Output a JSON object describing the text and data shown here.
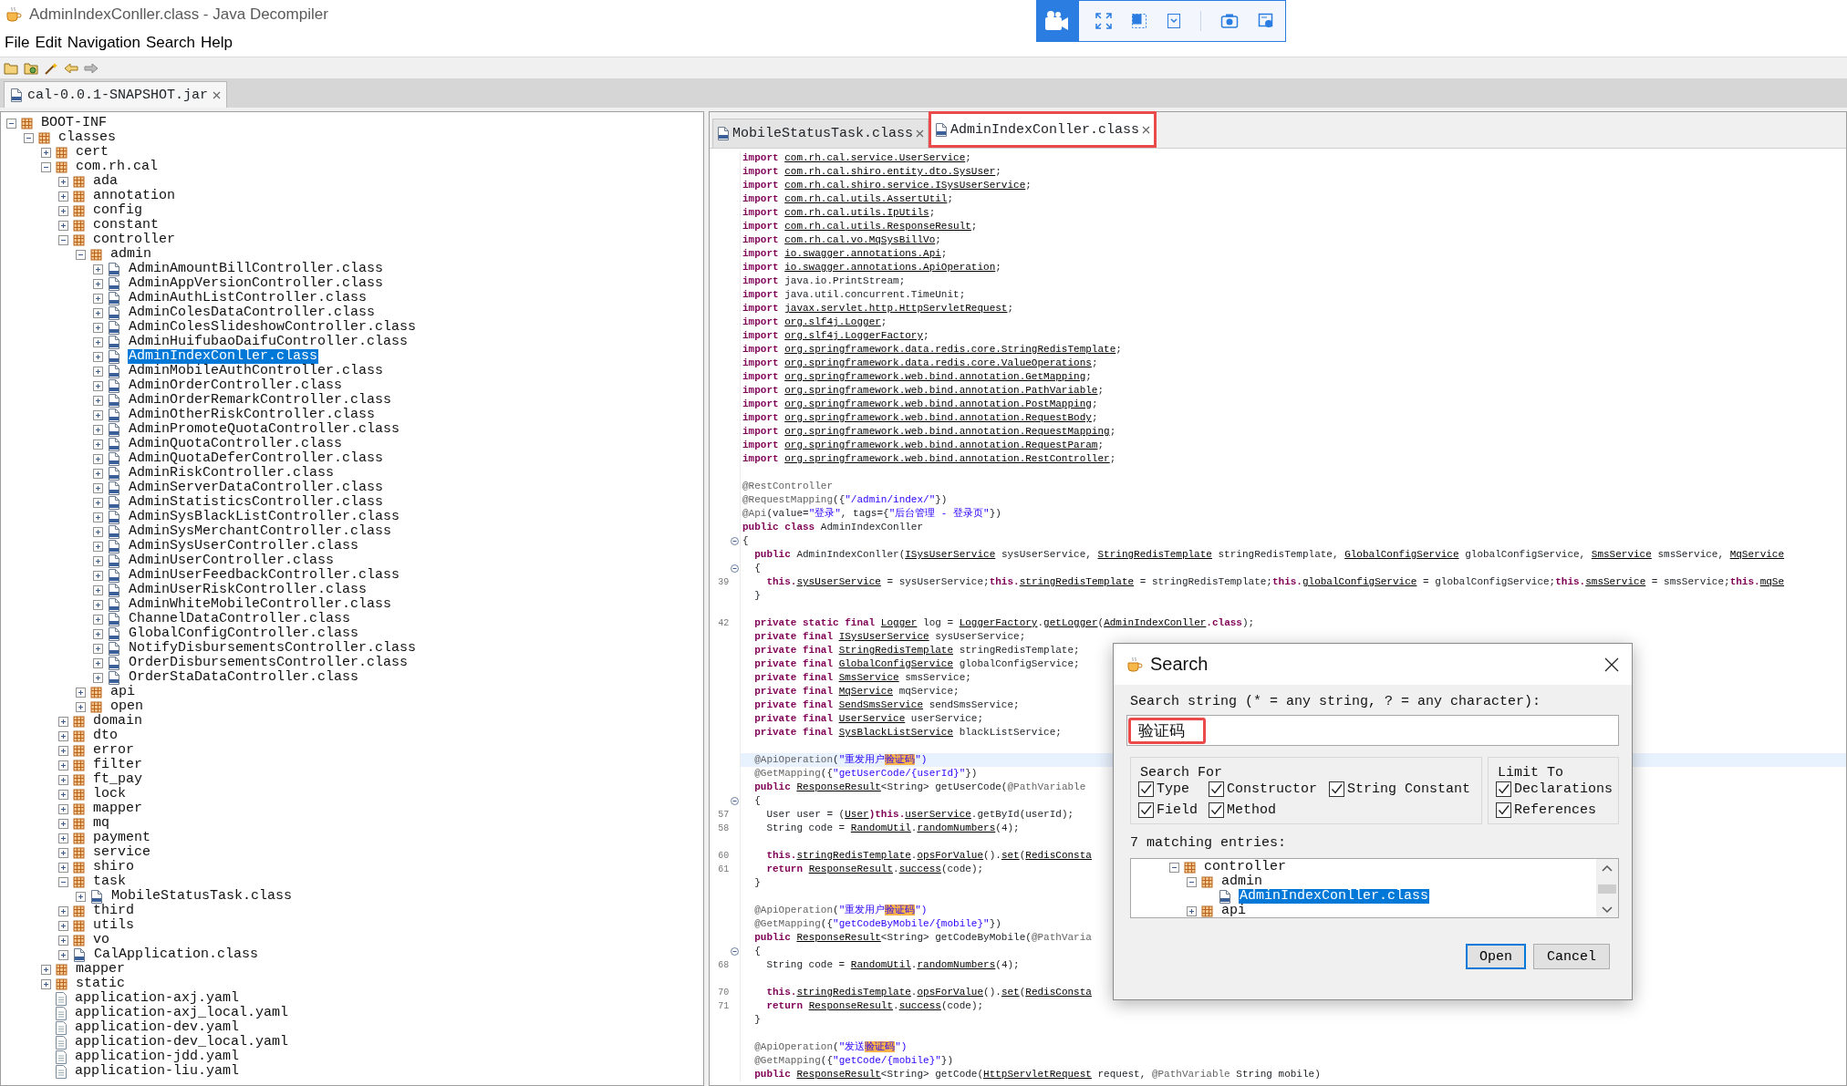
{
  "window": {
    "title": "AdminIndexConller.class - Java Decompiler"
  },
  "menu": [
    "File",
    "Edit",
    "Navigation",
    "Search",
    "Help"
  ],
  "file_tabs": [
    {
      "label": "cal-0.0.1-SNAPSHOT.jar",
      "selected": true
    }
  ],
  "tree": [
    {
      "label": "BOOT-INF",
      "kind": "package",
      "expanded": true,
      "selected": false,
      "children": [
        {
          "label": "classes",
          "kind": "package",
          "expanded": true,
          "selected": false,
          "children": [
            {
              "label": "cert",
              "kind": "package",
              "expanded": false,
              "selected": false
            },
            {
              "label": "com.rh.cal",
              "kind": "package",
              "expanded": true,
              "selected": false,
              "children": [
                {
                  "label": "ada",
                  "kind": "package",
                  "expanded": false,
                  "selected": false
                },
                {
                  "label": "annotation",
                  "kind": "package",
                  "expanded": false,
                  "selected": false
                },
                {
                  "label": "config",
                  "kind": "package",
                  "expanded": false,
                  "selected": false
                },
                {
                  "label": "constant",
                  "kind": "package",
                  "expanded": false,
                  "selected": false
                },
                {
                  "label": "controller",
                  "kind": "package",
                  "expanded": true,
                  "selected": false,
                  "children": [
                    {
                      "label": "admin",
                      "kind": "package",
                      "expanded": true,
                      "selected": false,
                      "children": [
                        {
                          "label": "AdminAmountBillController.class",
                          "kind": "class",
                          "expanded": false,
                          "selected": false
                        },
                        {
                          "label": "AdminAppVersionController.class",
                          "kind": "class",
                          "expanded": false,
                          "selected": false
                        },
                        {
                          "label": "AdminAuthListController.class",
                          "kind": "class",
                          "expanded": false,
                          "selected": false
                        },
                        {
                          "label": "AdminColesDataController.class",
                          "kind": "class",
                          "expanded": false,
                          "selected": false
                        },
                        {
                          "label": "AdminColesSlideshowController.class",
                          "kind": "class",
                          "expanded": false,
                          "selected": false
                        },
                        {
                          "label": "AdminHuifubaoDaifuController.class",
                          "kind": "class",
                          "expanded": false,
                          "selected": false
                        },
                        {
                          "label": "AdminIndexConller.class",
                          "kind": "class",
                          "expanded": false,
                          "selected": true
                        },
                        {
                          "label": "AdminMobileAuthController.class",
                          "kind": "class",
                          "expanded": false,
                          "selected": false
                        },
                        {
                          "label": "AdminOrderController.class",
                          "kind": "class",
                          "expanded": false,
                          "selected": false
                        },
                        {
                          "label": "AdminOrderRemarkController.class",
                          "kind": "class",
                          "expanded": false,
                          "selected": false
                        },
                        {
                          "label": "AdminOtherRiskController.class",
                          "kind": "class",
                          "expanded": false,
                          "selected": false
                        },
                        {
                          "label": "AdminPromoteQuotaController.class",
                          "kind": "class",
                          "expanded": false,
                          "selected": false
                        },
                        {
                          "label": "AdminQuotaController.class",
                          "kind": "class",
                          "expanded": false,
                          "selected": false
                        },
                        {
                          "label": "AdminQuotaDeferController.class",
                          "kind": "class",
                          "expanded": false,
                          "selected": false
                        },
                        {
                          "label": "AdminRiskController.class",
                          "kind": "class",
                          "expanded": false,
                          "selected": false
                        },
                        {
                          "label": "AdminServerDataController.class",
                          "kind": "class",
                          "expanded": false,
                          "selected": false
                        },
                        {
                          "label": "AdminStatisticsController.class",
                          "kind": "class",
                          "expanded": false,
                          "selected": false
                        },
                        {
                          "label": "AdminSysBlackListController.class",
                          "kind": "class",
                          "expanded": false,
                          "selected": false
                        },
                        {
                          "label": "AdminSysMerchantController.class",
                          "kind": "class",
                          "expanded": false,
                          "selected": false
                        },
                        {
                          "label": "AdminSysUserController.class",
                          "kind": "class",
                          "expanded": false,
                          "selected": false
                        },
                        {
                          "label": "AdminUserController.class",
                          "kind": "class",
                          "expanded": false,
                          "selected": false
                        },
                        {
                          "label": "AdminUserFeedbackController.class",
                          "kind": "class",
                          "expanded": false,
                          "selected": false
                        },
                        {
                          "label": "AdminUserRiskController.class",
                          "kind": "class",
                          "expanded": false,
                          "selected": false
                        },
                        {
                          "label": "AdminWhiteMobileController.class",
                          "kind": "class",
                          "expanded": false,
                          "selected": false
                        },
                        {
                          "label": "ChannelDataController.class",
                          "kind": "class",
                          "expanded": false,
                          "selected": false
                        },
                        {
                          "label": "GlobalConfigController.class",
                          "kind": "class",
                          "expanded": false,
                          "selected": false
                        },
                        {
                          "label": "NotifyDisbursementsController.class",
                          "kind": "class",
                          "expanded": false,
                          "selected": false
                        },
                        {
                          "label": "OrderDisbursementsController.class",
                          "kind": "class",
                          "expanded": false,
                          "selected": false
                        },
                        {
                          "label": "OrderStaDataController.class",
                          "kind": "class",
                          "expanded": false,
                          "selected": false
                        }
                      ]
                    },
                    {
                      "label": "api",
                      "kind": "package",
                      "expanded": false,
                      "selected": false
                    },
                    {
                      "label": "open",
                      "kind": "package",
                      "expanded": false,
                      "selected": false
                    }
                  ]
                },
                {
                  "label": "domain",
                  "kind": "package",
                  "expanded": false,
                  "selected": false
                },
                {
                  "label": "dto",
                  "kind": "package",
                  "expanded": false,
                  "selected": false
                },
                {
                  "label": "error",
                  "kind": "package",
                  "expanded": false,
                  "selected": false
                },
                {
                  "label": "filter",
                  "kind": "package",
                  "expanded": false,
                  "selected": false
                },
                {
                  "label": "ft_pay",
                  "kind": "package",
                  "expanded": false,
                  "selected": false
                },
                {
                  "label": "lock",
                  "kind": "package",
                  "expanded": false,
                  "selected": false
                },
                {
                  "label": "mapper",
                  "kind": "package",
                  "expanded": false,
                  "selected": false
                },
                {
                  "label": "mq",
                  "kind": "package",
                  "expanded": false,
                  "selected": false
                },
                {
                  "label": "payment",
                  "kind": "package",
                  "expanded": false,
                  "selected": false
                },
                {
                  "label": "service",
                  "kind": "package",
                  "expanded": false,
                  "selected": false
                },
                {
                  "label": "shiro",
                  "kind": "package",
                  "expanded": false,
                  "selected": false
                },
                {
                  "label": "task",
                  "kind": "package",
                  "expanded": true,
                  "selected": false,
                  "children": [
                    {
                      "label": "MobileStatusTask.class",
                      "kind": "class",
                      "expanded": false,
                      "selected": false
                    }
                  ]
                },
                {
                  "label": "third",
                  "kind": "package",
                  "expanded": false,
                  "selected": false
                },
                {
                  "label": "utils",
                  "kind": "package",
                  "expanded": false,
                  "selected": false
                },
                {
                  "label": "vo",
                  "kind": "package",
                  "expanded": false,
                  "selected": false
                },
                {
                  "label": "CalApplication.class",
                  "kind": "class",
                  "expanded": false,
                  "selected": false
                }
              ]
            },
            {
              "label": "mapper",
              "kind": "package",
              "expanded": false,
              "selected": false
            },
            {
              "label": "static",
              "kind": "package",
              "expanded": false,
              "selected": false
            },
            {
              "label": "application-axj.yaml",
              "kind": "file",
              "selected": false
            },
            {
              "label": "application-axj_local.yaml",
              "kind": "file",
              "selected": false
            },
            {
              "label": "application-dev.yaml",
              "kind": "file",
              "selected": false
            },
            {
              "label": "application-dev_local.yaml",
              "kind": "file",
              "selected": false
            },
            {
              "label": "application-jdd.yaml",
              "kind": "file",
              "selected": false
            },
            {
              "label": "application-liu.yaml",
              "kind": "file",
              "selected": false
            }
          ]
        }
      ]
    }
  ],
  "editor_tabs": [
    {
      "label": "MobileStatusTask.class",
      "selected": false,
      "marked": false
    },
    {
      "label": "AdminIndexConller.class",
      "selected": true,
      "marked": true
    }
  ],
  "code": [
    {
      "current": false,
      "fold": false,
      "tokens": [
        {
          "kind": "kw",
          "text": "import "
        },
        {
          "kind": "ref",
          "text": "com.rh.cal.service.UserService"
        },
        {
          "kind": "p",
          "text": ";"
        }
      ]
    },
    {
      "current": false,
      "fold": false,
      "tokens": [
        {
          "kind": "kw",
          "text": "import "
        },
        {
          "kind": "ref",
          "text": "com.rh.cal.shiro.entity.dto.SysUser"
        },
        {
          "kind": "p",
          "text": ";"
        }
      ]
    },
    {
      "current": false,
      "fold": false,
      "tokens": [
        {
          "kind": "kw",
          "text": "import "
        },
        {
          "kind": "ref",
          "text": "com.rh.cal.shiro.service.ISysUserService"
        },
        {
          "kind": "p",
          "text": ";"
        }
      ]
    },
    {
      "current": false,
      "fold": false,
      "tokens": [
        {
          "kind": "kw",
          "text": "import "
        },
        {
          "kind": "ref",
          "text": "com.rh.cal.utils.AssertUtil"
        },
        {
          "kind": "p",
          "text": ";"
        }
      ]
    },
    {
      "current": false,
      "fold": false,
      "tokens": [
        {
          "kind": "kw",
          "text": "import "
        },
        {
          "kind": "ref",
          "text": "com.rh.cal.utils.IpUtils"
        },
        {
          "kind": "p",
          "text": ";"
        }
      ]
    },
    {
      "current": false,
      "fold": false,
      "tokens": [
        {
          "kind": "kw",
          "text": "import "
        },
        {
          "kind": "ref",
          "text": "com.rh.cal.utils.ResponseResult"
        },
        {
          "kind": "p",
          "text": ";"
        }
      ]
    },
    {
      "current": false,
      "fold": false,
      "tokens": [
        {
          "kind": "kw",
          "text": "import "
        },
        {
          "kind": "ref",
          "text": "com.rh.cal.vo.MqSysBillVo"
        },
        {
          "kind": "p",
          "text": ";"
        }
      ]
    },
    {
      "current": false,
      "fold": false,
      "tokens": [
        {
          "kind": "kw",
          "text": "import "
        },
        {
          "kind": "ref",
          "text": "io.swagger.annotations.Api"
        },
        {
          "kind": "p",
          "text": ";"
        }
      ]
    },
    {
      "current": false,
      "fold": false,
      "tokens": [
        {
          "kind": "kw",
          "text": "import "
        },
        {
          "kind": "ref",
          "text": "io.swagger.annotations.ApiOperation"
        },
        {
          "kind": "p",
          "text": ";"
        }
      ]
    },
    {
      "current": false,
      "fold": false,
      "tokens": [
        {
          "kind": "kw",
          "text": "import "
        },
        {
          "kind": "p",
          "text": "java.io.PrintStream;"
        }
      ]
    },
    {
      "current": false,
      "fold": false,
      "tokens": [
        {
          "kind": "kw",
          "text": "import "
        },
        {
          "kind": "p",
          "text": "java.util.concurrent.TimeUnit;"
        }
      ]
    },
    {
      "current": false,
      "fold": false,
      "tokens": [
        {
          "kind": "kw",
          "text": "import "
        },
        {
          "kind": "ref",
          "text": "javax.servlet.http.HttpServletRequest"
        },
        {
          "kind": "p",
          "text": ";"
        }
      ]
    },
    {
      "current": false,
      "fold": false,
      "tokens": [
        {
          "kind": "kw",
          "text": "import "
        },
        {
          "kind": "ref",
          "text": "org.slf4j.Logger"
        },
        {
          "kind": "p",
          "text": ";"
        }
      ]
    },
    {
      "current": false,
      "fold": false,
      "tokens": [
        {
          "kind": "kw",
          "text": "import "
        },
        {
          "kind": "ref",
          "text": "org.slf4j.LoggerFactory"
        },
        {
          "kind": "p",
          "text": ";"
        }
      ]
    },
    {
      "current": false,
      "fold": false,
      "tokens": [
        {
          "kind": "kw",
          "text": "import "
        },
        {
          "kind": "ref",
          "text": "org.springframework.data.redis.core.StringRedisTemplate"
        },
        {
          "kind": "p",
          "text": ";"
        }
      ]
    },
    {
      "current": false,
      "fold": false,
      "tokens": [
        {
          "kind": "kw",
          "text": "import "
        },
        {
          "kind": "ref",
          "text": "org.springframework.data.redis.core.ValueOperations"
        },
        {
          "kind": "p",
          "text": ";"
        }
      ]
    },
    {
      "current": false,
      "fold": false,
      "tokens": [
        {
          "kind": "kw",
          "text": "import "
        },
        {
          "kind": "ref",
          "text": "org.springframework.web.bind.annotation.GetMapping"
        },
        {
          "kind": "p",
          "text": ";"
        }
      ]
    },
    {
      "current": false,
      "fold": false,
      "tokens": [
        {
          "kind": "kw",
          "text": "import "
        },
        {
          "kind": "ref",
          "text": "org.springframework.web.bind.annotation.PathVariable"
        },
        {
          "kind": "p",
          "text": ";"
        }
      ]
    },
    {
      "current": false,
      "fold": false,
      "tokens": [
        {
          "kind": "kw",
          "text": "import "
        },
        {
          "kind": "ref",
          "text": "org.springframework.web.bind.annotation.PostMapping"
        },
        {
          "kind": "p",
          "text": ";"
        }
      ]
    },
    {
      "current": false,
      "fold": false,
      "tokens": [
        {
          "kind": "kw",
          "text": "import "
        },
        {
          "kind": "ref",
          "text": "org.springframework.web.bind.annotation.RequestBody"
        },
        {
          "kind": "p",
          "text": ";"
        }
      ]
    },
    {
      "current": false,
      "fold": false,
      "tokens": [
        {
          "kind": "kw",
          "text": "import "
        },
        {
          "kind": "ref",
          "text": "org.springframework.web.bind.annotation.RequestMapping"
        },
        {
          "kind": "p",
          "text": ";"
        }
      ]
    },
    {
      "current": false,
      "fold": false,
      "tokens": [
        {
          "kind": "kw",
          "text": "import "
        },
        {
          "kind": "ref",
          "text": "org.springframework.web.bind.annotation.RequestParam"
        },
        {
          "kind": "p",
          "text": ";"
        }
      ]
    },
    {
      "current": false,
      "fold": false,
      "tokens": [
        {
          "kind": "kw",
          "text": "import "
        },
        {
          "kind": "ref",
          "text": "org.springframework.web.bind.annotation.RestController"
        },
        {
          "kind": "p",
          "text": ";"
        }
      ]
    },
    {
      "current": false,
      "fold": false
    },
    {
      "current": false,
      "fold": false,
      "tokens": [
        {
          "kind": "ann",
          "text": "@RestController"
        }
      ]
    },
    {
      "current": false,
      "fold": false,
      "tokens": [
        {
          "kind": "ann",
          "text": "@RequestMapping"
        },
        {
          "kind": "p",
          "text": "({"
        },
        {
          "kind": "str",
          "text": "\"/admin/index/\""
        },
        {
          "kind": "p",
          "text": "})"
        }
      ]
    },
    {
      "current": false,
      "fold": false,
      "tokens": [
        {
          "kind": "ann",
          "text": "@Api"
        },
        {
          "kind": "p",
          "text": "(value="
        },
        {
          "kind": "str",
          "text": "\"登录\""
        },
        {
          "kind": "p",
          "text": ", tags={"
        },
        {
          "kind": "str",
          "text": "\"后台管理 - 登录页\""
        },
        {
          "kind": "p",
          "text": "})"
        }
      ]
    },
    {
      "current": false,
      "fold": false,
      "tokens": [
        {
          "kind": "kw",
          "text": "public class "
        },
        {
          "kind": "p",
          "text": "AdminIndexConller"
        }
      ]
    },
    {
      "current": false,
      "fold": true,
      "tokens": [
        {
          "kind": "p",
          "text": "{"
        }
      ]
    },
    {
      "current": false,
      "fold": false,
      "tokens": [
        {
          "kind": "kw",
          "text": "  public "
        },
        {
          "kind": "p",
          "text": "AdminIndexConller("
        },
        {
          "kind": "ref",
          "text": "ISysUserService"
        },
        {
          "kind": "p",
          "text": " sysUserService, "
        },
        {
          "kind": "ref",
          "text": "StringRedisTemplate"
        },
        {
          "kind": "p",
          "text": " stringRedisTemplate, "
        },
        {
          "kind": "ref",
          "text": "GlobalConfigService"
        },
        {
          "kind": "p",
          "text": " globalConfigService, "
        },
        {
          "kind": "ref",
          "text": "SmsService"
        },
        {
          "kind": "p",
          "text": " smsService, "
        },
        {
          "kind": "ref",
          "text": "MqService"
        }
      ]
    },
    {
      "current": false,
      "fold": true,
      "tokens": [
        {
          "kind": "p",
          "text": "  {"
        }
      ]
    },
    {
      "number": "39",
      "current": false,
      "fold": false,
      "tokens": [
        {
          "kind": "kw",
          "text": "    this."
        },
        {
          "kind": "ref",
          "text": "sysUserService"
        },
        {
          "kind": "p",
          "text": " = sysUserService;"
        },
        {
          "kind": "kw",
          "text": "this."
        },
        {
          "kind": "ref",
          "text": "stringRedisTemplate"
        },
        {
          "kind": "p",
          "text": " = stringRedisTemplate;"
        },
        {
          "kind": "kw",
          "text": "this."
        },
        {
          "kind": "ref",
          "text": "globalConfigService"
        },
        {
          "kind": "p",
          "text": " = globalConfigService;"
        },
        {
          "kind": "kw",
          "text": "this."
        },
        {
          "kind": "ref",
          "text": "smsService"
        },
        {
          "kind": "p",
          "text": " = smsService;"
        },
        {
          "kind": "kw",
          "text": "this."
        },
        {
          "kind": "ref",
          "text": "mqSe"
        }
      ]
    },
    {
      "current": false,
      "fold": false,
      "tokens": [
        {
          "kind": "p",
          "text": "  }"
        }
      ]
    },
    {
      "current": false,
      "fold": false
    },
    {
      "number": "42",
      "current": false,
      "fold": false,
      "tokens": [
        {
          "kind": "kw",
          "text": "  private static final "
        },
        {
          "kind": "ref",
          "text": "Logger"
        },
        {
          "kind": "p",
          "text": " log = "
        },
        {
          "kind": "ref",
          "text": "LoggerFactory"
        },
        {
          "kind": "p",
          "text": "."
        },
        {
          "kind": "ref",
          "text": "getLogger"
        },
        {
          "kind": "p",
          "text": "("
        },
        {
          "kind": "ref",
          "text": "AdminIndexConller"
        },
        {
          "kind": "kw",
          "text": ".class"
        },
        {
          "kind": "p",
          "text": ");"
        }
      ]
    },
    {
      "current": false,
      "fold": false,
      "tokens": [
        {
          "kind": "kw",
          "text": "  private final "
        },
        {
          "kind": "ref",
          "text": "ISysUserService"
        },
        {
          "kind": "p",
          "text": " sysUserService;"
        }
      ]
    },
    {
      "current": false,
      "fold": false,
      "tokens": [
        {
          "kind": "kw",
          "text": "  private final "
        },
        {
          "kind": "ref",
          "text": "StringRedisTemplate"
        },
        {
          "kind": "p",
          "text": " stringRedisTemplate;"
        }
      ]
    },
    {
      "current": false,
      "fold": false,
      "tokens": [
        {
          "kind": "kw",
          "text": "  private final "
        },
        {
          "kind": "ref",
          "text": "GlobalConfigService"
        },
        {
          "kind": "p",
          "text": " globalConfigService;"
        }
      ]
    },
    {
      "current": false,
      "fold": false,
      "tokens": [
        {
          "kind": "kw",
          "text": "  private final "
        },
        {
          "kind": "ref",
          "text": "SmsService"
        },
        {
          "kind": "p",
          "text": " smsService;"
        }
      ]
    },
    {
      "current": false,
      "fold": false,
      "tokens": [
        {
          "kind": "kw",
          "text": "  private final "
        },
        {
          "kind": "ref",
          "text": "MqService"
        },
        {
          "kind": "p",
          "text": " mqService;"
        }
      ]
    },
    {
      "current": false,
      "fold": false,
      "tokens": [
        {
          "kind": "kw",
          "text": "  private final "
        },
        {
          "kind": "ref",
          "text": "SendSmsService"
        },
        {
          "kind": "p",
          "text": " sendSmsService;"
        }
      ]
    },
    {
      "current": false,
      "fold": false,
      "tokens": [
        {
          "kind": "kw",
          "text": "  private final "
        },
        {
          "kind": "ref",
          "text": "UserService"
        },
        {
          "kind": "p",
          "text": " userService;"
        }
      ]
    },
    {
      "current": false,
      "fold": false,
      "tokens": [
        {
          "kind": "kw",
          "text": "  private final "
        },
        {
          "kind": "ref",
          "text": "SysBlackListService"
        },
        {
          "kind": "p",
          "text": " blackListService;"
        }
      ]
    },
    {
      "current": false,
      "fold": false
    },
    {
      "current": true,
      "fold": false,
      "tokens": [
        {
          "kind": "ann",
          "text": "  @ApiOperation"
        },
        {
          "kind": "p",
          "text": "("
        },
        {
          "kind": "str",
          "text": "\"重发用户"
        },
        {
          "kind": "hit",
          "text": "验证码"
        },
        {
          "kind": "str",
          "text": "\")"
        }
      ]
    },
    {
      "current": false,
      "fold": false,
      "tokens": [
        {
          "kind": "ann",
          "text": "  @GetMapping"
        },
        {
          "kind": "p",
          "text": "({"
        },
        {
          "kind": "str",
          "text": "\"getUserCode/{userId}\""
        },
        {
          "kind": "p",
          "text": "})"
        }
      ]
    },
    {
      "current": false,
      "fold": false,
      "tokens": [
        {
          "kind": "kw",
          "text": "  public "
        },
        {
          "kind": "ref",
          "text": "ResponseResult"
        },
        {
          "kind": "p",
          "text": "<String> getUserCode("
        },
        {
          "kind": "ann",
          "text": "@PathVariable"
        }
      ]
    },
    {
      "current": false,
      "fold": true,
      "tokens": [
        {
          "kind": "p",
          "text": "  {"
        }
      ]
    },
    {
      "number": "57",
      "current": false,
      "fold": false,
      "tokens": [
        {
          "kind": "p",
          "text": "    User user = ("
        },
        {
          "kind": "ref",
          "text": "User"
        },
        {
          "kind": "kw",
          "text": ")this."
        },
        {
          "kind": "ref",
          "text": "userService"
        },
        {
          "kind": "p",
          "text": ".getById(userId);"
        }
      ]
    },
    {
      "number": "58",
      "current": false,
      "fold": false,
      "tokens": [
        {
          "kind": "p",
          "text": "    String code = "
        },
        {
          "kind": "ref",
          "text": "RandomUtil"
        },
        {
          "kind": "p",
          "text": "."
        },
        {
          "kind": "ref",
          "text": "randomNumbers"
        },
        {
          "kind": "p",
          "text": "(4);"
        }
      ]
    },
    {
      "current": false,
      "fold": false
    },
    {
      "number": "60",
      "current": false,
      "fold": false,
      "tokens": [
        {
          "kind": "kw",
          "text": "    this."
        },
        {
          "kind": "ref",
          "text": "stringRedisTemplate"
        },
        {
          "kind": "p",
          "text": "."
        },
        {
          "kind": "ref",
          "text": "opsForValue"
        },
        {
          "kind": "p",
          "text": "()."
        },
        {
          "kind": "ref",
          "text": "set"
        },
        {
          "kind": "p",
          "text": "("
        },
        {
          "kind": "ref",
          "text": "RedisConsta"
        }
      ]
    },
    {
      "number": "61",
      "current": false,
      "fold": false,
      "tokens": [
        {
          "kind": "kw",
          "text": "    return "
        },
        {
          "kind": "ref",
          "text": "ResponseResult"
        },
        {
          "kind": "p",
          "text": "."
        },
        {
          "kind": "ref",
          "text": "success"
        },
        {
          "kind": "p",
          "text": "(code);"
        }
      ]
    },
    {
      "current": false,
      "fold": false,
      "tokens": [
        {
          "kind": "p",
          "text": "  }"
        }
      ]
    },
    {
      "current": false,
      "fold": false
    },
    {
      "current": false,
      "fold": false,
      "tokens": [
        {
          "kind": "ann",
          "text": "  @ApiOperation"
        },
        {
          "kind": "p",
          "text": "("
        },
        {
          "kind": "str",
          "text": "\"重发用户"
        },
        {
          "kind": "hit",
          "text": "验证码"
        },
        {
          "kind": "str",
          "text": "\")"
        }
      ]
    },
    {
      "current": false,
      "fold": false,
      "tokens": [
        {
          "kind": "ann",
          "text": "  @GetMapping"
        },
        {
          "kind": "p",
          "text": "({"
        },
        {
          "kind": "str",
          "text": "\"getCodeByMobile/{mobile}\""
        },
        {
          "kind": "p",
          "text": "})"
        }
      ]
    },
    {
      "current": false,
      "fold": false,
      "tokens": [
        {
          "kind": "kw",
          "text": "  public "
        },
        {
          "kind": "ref",
          "text": "ResponseResult"
        },
        {
          "kind": "p",
          "text": "<String> getCodeByMobile("
        },
        {
          "kind": "ann",
          "text": "@PathVaria"
        }
      ]
    },
    {
      "current": false,
      "fold": true,
      "tokens": [
        {
          "kind": "p",
          "text": "  {"
        }
      ]
    },
    {
      "number": "68",
      "current": false,
      "fold": false,
      "tokens": [
        {
          "kind": "p",
          "text": "    String code = "
        },
        {
          "kind": "ref",
          "text": "RandomUtil"
        },
        {
          "kind": "p",
          "text": "."
        },
        {
          "kind": "ref",
          "text": "randomNumbers"
        },
        {
          "kind": "p",
          "text": "(4);"
        }
      ]
    },
    {
      "current": false,
      "fold": false
    },
    {
      "number": "70",
      "current": false,
      "fold": false,
      "tokens": [
        {
          "kind": "kw",
          "text": "    this."
        },
        {
          "kind": "ref",
          "text": "stringRedisTemplate"
        },
        {
          "kind": "p",
          "text": "."
        },
        {
          "kind": "ref",
          "text": "opsForValue"
        },
        {
          "kind": "p",
          "text": "()."
        },
        {
          "kind": "ref",
          "text": "set"
        },
        {
          "kind": "p",
          "text": "("
        },
        {
          "kind": "ref",
          "text": "RedisConsta"
        }
      ]
    },
    {
      "number": "71",
      "current": false,
      "fold": false,
      "tokens": [
        {
          "kind": "kw",
          "text": "    return "
        },
        {
          "kind": "ref",
          "text": "ResponseResult"
        },
        {
          "kind": "p",
          "text": "."
        },
        {
          "kind": "ref",
          "text": "success"
        },
        {
          "kind": "p",
          "text": "(code);"
        }
      ]
    },
    {
      "current": false,
      "fold": false,
      "tokens": [
        {
          "kind": "p",
          "text": "  }"
        }
      ]
    },
    {
      "current": false,
      "fold": false
    },
    {
      "current": false,
      "fold": false,
      "tokens": [
        {
          "kind": "ann",
          "text": "  @ApiOperation"
        },
        {
          "kind": "p",
          "text": "("
        },
        {
          "kind": "str",
          "text": "\"发送"
        },
        {
          "kind": "hit",
          "text": "验证码"
        },
        {
          "kind": "str",
          "text": "\")"
        }
      ]
    },
    {
      "current": false,
      "fold": false,
      "tokens": [
        {
          "kind": "ann",
          "text": "  @GetMapping"
        },
        {
          "kind": "p",
          "text": "({"
        },
        {
          "kind": "str",
          "text": "\"getCode/{mobile}\""
        },
        {
          "kind": "p",
          "text": "})"
        }
      ]
    },
    {
      "current": false,
      "fold": false,
      "tokens": [
        {
          "kind": "kw",
          "text": "  public "
        },
        {
          "kind": "ref",
          "text": "ResponseResult"
        },
        {
          "kind": "p",
          "text": "<String> getCode("
        },
        {
          "kind": "ref",
          "text": "HttpServletRequest"
        },
        {
          "kind": "p",
          "text": " request, "
        },
        {
          "kind": "ann",
          "text": "@PathVariable"
        },
        {
          "kind": "p",
          "text": " String mobile)"
        }
      ]
    }
  ],
  "dialog": {
    "title": "Search",
    "prompt": "Search string (* = any string, ? = any character):",
    "field": {
      "value": "验证码",
      "marked": true
    },
    "search_for": {
      "title": "Search For",
      "options": [
        {
          "label": "Type",
          "checked": true
        },
        {
          "label": "Constructor",
          "checked": true
        },
        {
          "label": "String Constant",
          "checked": true
        },
        {
          "label": "Field",
          "checked": true
        },
        {
          "label": "Method",
          "checked": true
        }
      ]
    },
    "limit_to": {
      "title": "Limit To",
      "options": [
        {
          "label": "Declarations",
          "checked": true
        },
        {
          "label": "References",
          "checked": true
        }
      ]
    },
    "result_count": "7 matching entries:",
    "results": [
      {
        "label": "controller",
        "kind": "package",
        "expanded": true,
        "selected": false,
        "children": [
          {
            "label": "admin",
            "kind": "package",
            "expanded": true,
            "selected": false,
            "children": [
              {
                "label": "AdminIndexConller.class",
                "kind": "class",
                "selected": true
              }
            ]
          },
          {
            "label": "api",
            "kind": "package",
            "expanded": false,
            "selected": false
          }
        ]
      }
    ],
    "buttons": [
      {
        "label": "Open",
        "default": true
      },
      {
        "label": "Cancel",
        "default": false
      }
    ]
  }
}
